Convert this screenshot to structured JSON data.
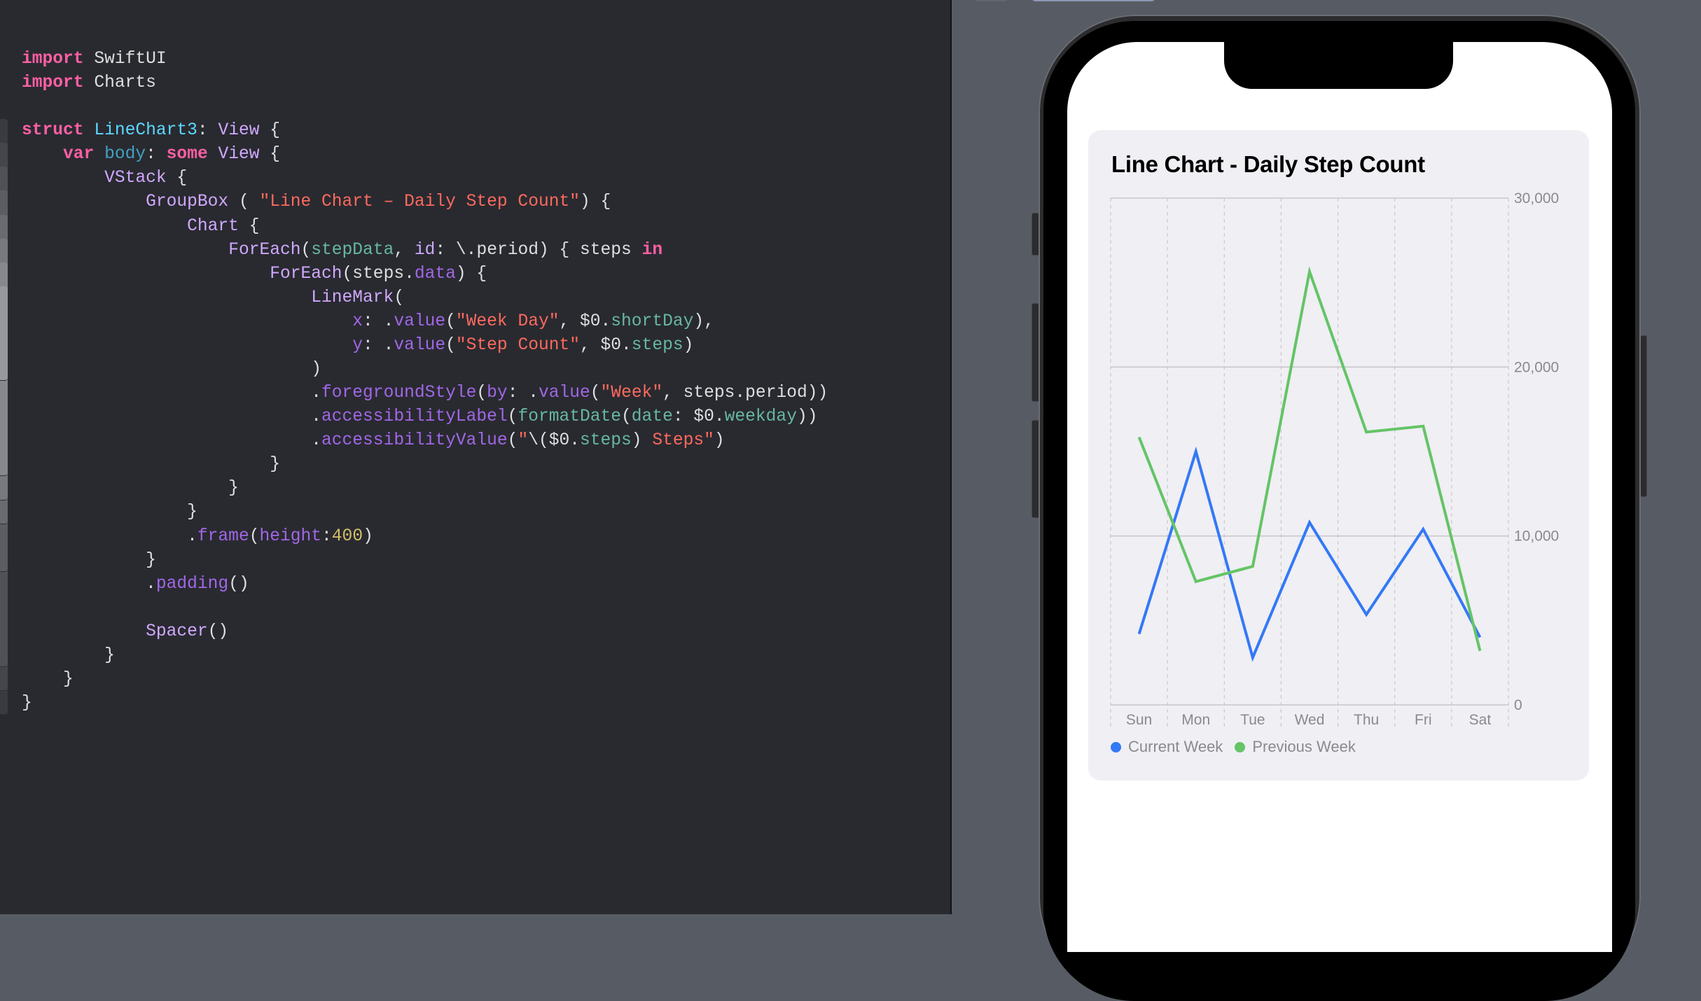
{
  "editor": {
    "lines": [
      [
        [
          "kw",
          "import"
        ],
        [
          "pl",
          " SwiftUI"
        ]
      ],
      [
        [
          "kw",
          "import"
        ],
        [
          "pl",
          " Charts"
        ]
      ],
      [],
      [
        [
          "kw",
          "struct"
        ],
        [
          "pl",
          " "
        ],
        [
          "tyd",
          "LineChart3"
        ],
        [
          "pl",
          ": "
        ],
        [
          "ty",
          "View"
        ],
        [
          "pl",
          " {"
        ]
      ],
      [
        [
          "pl",
          "    "
        ],
        [
          "kw",
          "var"
        ],
        [
          "pl",
          " "
        ],
        [
          "var",
          "body"
        ],
        [
          "pl",
          ": "
        ],
        [
          "kw",
          "some"
        ],
        [
          "pl",
          " "
        ],
        [
          "ty",
          "View"
        ],
        [
          "pl",
          " {"
        ]
      ],
      [
        [
          "pl",
          "        "
        ],
        [
          "ty",
          "VStack"
        ],
        [
          "pl",
          " {"
        ]
      ],
      [
        [
          "pl",
          "            "
        ],
        [
          "ty",
          "GroupBox"
        ],
        [
          "pl",
          " ( "
        ],
        [
          "str",
          "\"Line Chart – Daily Step Count\""
        ],
        [
          "pl",
          ") {"
        ]
      ],
      [
        [
          "pl",
          "                "
        ],
        [
          "ty",
          "Chart"
        ],
        [
          "pl",
          " {"
        ]
      ],
      [
        [
          "pl",
          "                    "
        ],
        [
          "ty",
          "ForEach"
        ],
        [
          "pl",
          "("
        ],
        [
          "prp",
          "stepData"
        ],
        [
          "pl",
          ", "
        ],
        [
          "ty",
          "id"
        ],
        [
          "pl",
          ": \\.period) { steps "
        ],
        [
          "kw",
          "in"
        ]
      ],
      [
        [
          "pl",
          "                        "
        ],
        [
          "ty",
          "ForEach"
        ],
        [
          "pl",
          "(steps."
        ],
        [
          "fn",
          "data"
        ],
        [
          "pl",
          ") {"
        ]
      ],
      [
        [
          "pl",
          "                            "
        ],
        [
          "ty",
          "LineMark"
        ],
        [
          "pl",
          "("
        ]
      ],
      [
        [
          "pl",
          "                                "
        ],
        [
          "fn",
          "x"
        ],
        [
          "pl",
          ": ."
        ],
        [
          "fn",
          "value"
        ],
        [
          "pl",
          "("
        ],
        [
          "str",
          "\"Week Day\""
        ],
        [
          "pl",
          ", $0."
        ],
        [
          "prp",
          "shortDay"
        ],
        [
          "pl",
          "),"
        ]
      ],
      [
        [
          "pl",
          "                                "
        ],
        [
          "fn",
          "y"
        ],
        [
          "pl",
          ": ."
        ],
        [
          "fn",
          "value"
        ],
        [
          "pl",
          "("
        ],
        [
          "str",
          "\"Step Count\""
        ],
        [
          "pl",
          ", $0."
        ],
        [
          "prp",
          "steps"
        ],
        [
          "pl",
          ")"
        ]
      ],
      [
        [
          "pl",
          "                            )"
        ]
      ],
      [
        [
          "pl",
          "                            ."
        ],
        [
          "fn",
          "foregroundStyle"
        ],
        [
          "pl",
          "("
        ],
        [
          "fn",
          "by"
        ],
        [
          "pl",
          ": ."
        ],
        [
          "fn",
          "value"
        ],
        [
          "pl",
          "("
        ],
        [
          "str",
          "\"Week\""
        ],
        [
          "pl",
          ", steps.period))"
        ]
      ],
      [
        [
          "pl",
          "                            ."
        ],
        [
          "fn",
          "accessibilityLabel"
        ],
        [
          "pl",
          "("
        ],
        [
          "prp",
          "formatDate"
        ],
        [
          "pl",
          "("
        ],
        [
          "prp",
          "date"
        ],
        [
          "pl",
          ": $0."
        ],
        [
          "prp",
          "weekday"
        ],
        [
          "pl",
          "))"
        ]
      ],
      [
        [
          "pl",
          "                            ."
        ],
        [
          "fn",
          "accessibilityValue"
        ],
        [
          "pl",
          "("
        ],
        [
          "str",
          "\""
        ],
        [
          "pl",
          "\\($0."
        ],
        [
          "prp",
          "steps"
        ],
        [
          "pl",
          ")"
        ],
        [
          "str",
          " Steps\""
        ],
        [
          "pl",
          ")"
        ]
      ],
      [
        [
          "pl",
          "                        }"
        ]
      ],
      [
        [
          "pl",
          "                    }"
        ]
      ],
      [
        [
          "pl",
          "                }"
        ]
      ],
      [
        [
          "pl",
          "                ."
        ],
        [
          "fn",
          "frame"
        ],
        [
          "pl",
          "("
        ],
        [
          "fn",
          "height"
        ],
        [
          "pl",
          ":"
        ],
        [
          "num",
          "400"
        ],
        [
          "pl",
          ")"
        ]
      ],
      [
        [
          "pl",
          "            }"
        ]
      ],
      [
        [
          "pl",
          "            ."
        ],
        [
          "fn",
          "padding"
        ],
        [
          "pl",
          "()"
        ]
      ],
      [],
      [
        [
          "pl",
          "            "
        ],
        [
          "ty",
          "Spacer"
        ],
        [
          "pl",
          "()"
        ]
      ],
      [
        [
          "pl",
          "        }"
        ]
      ],
      [
        [
          "pl",
          "    }"
        ]
      ],
      [
        [
          "pl",
          "}"
        ]
      ]
    ]
  },
  "preview": {
    "groupbox_title": "Line Chart - Daily Step Count",
    "legend": [
      {
        "label": "Current Week",
        "color": "#3478f6"
      },
      {
        "label": "Previous Week",
        "color": "#65c466"
      }
    ]
  },
  "chart_data": {
    "type": "line",
    "title": "Line Chart - Daily Step Count",
    "xlabel": "Week Day",
    "ylabel": "Step Count",
    "categories": [
      "Sun",
      "Mon",
      "Tue",
      "Wed",
      "Thu",
      "Fri",
      "Sat"
    ],
    "series": [
      {
        "name": "Current Week",
        "color": "#3478f6",
        "values": [
          4200,
          15000,
          2800,
          10800,
          5350,
          10400,
          4000
        ]
      },
      {
        "name": "Previous Week",
        "color": "#65c466",
        "values": [
          15850,
          7300,
          8200,
          25650,
          16150,
          16500,
          3200
        ]
      }
    ],
    "ylim": [
      0,
      30000
    ],
    "yticks": [
      0,
      10000,
      20000,
      30000
    ],
    "ytick_labels": [
      "0",
      "10,000",
      "20,000",
      "30,000"
    ],
    "yaxis_position": "right",
    "grid": true,
    "legend_position": "bottom-left"
  }
}
